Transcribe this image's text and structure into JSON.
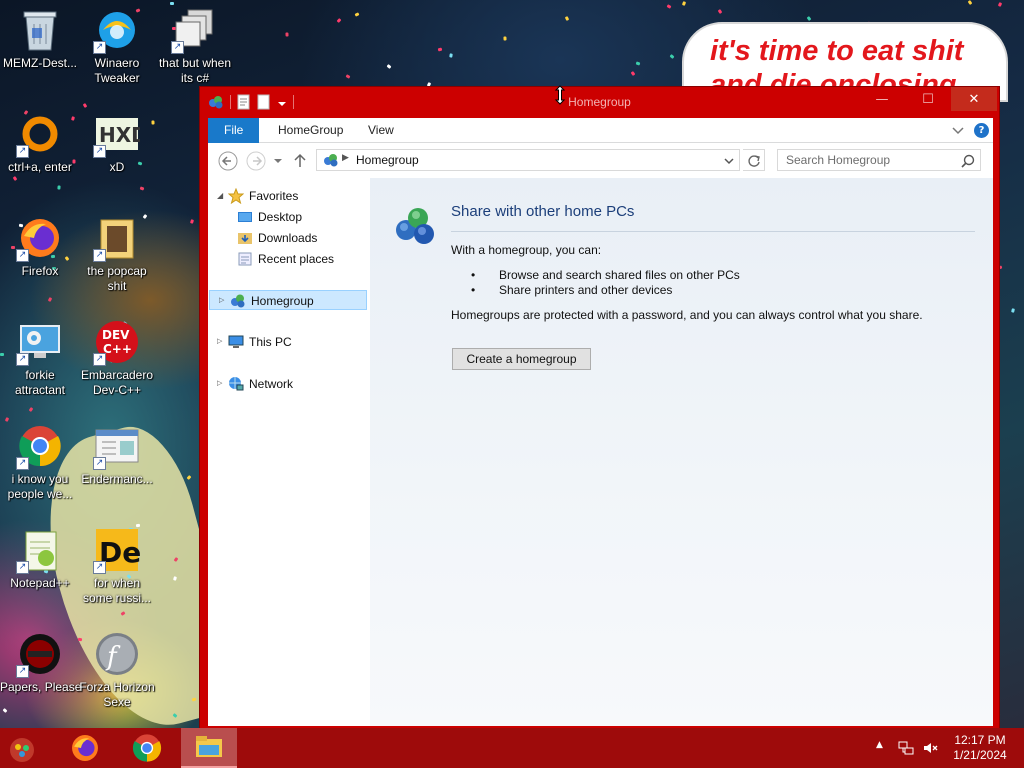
{
  "wallpaper": {
    "bubble_text": "it's time to eat shit\nand die onclosing"
  },
  "desktop_icons": [
    {
      "label": "MEMZ-Dest...",
      "icon": "recycle-bin"
    },
    {
      "label": "Winaero\nTweaker",
      "icon": "winaero"
    },
    {
      "label": "that but when\nits c#",
      "icon": "windows-stack"
    },
    {
      "label": "ctrl+a, enter",
      "icon": "orange-ring"
    },
    {
      "label": "xD",
      "icon": "hxd"
    },
    {
      "label": "Firefox",
      "icon": "firefox"
    },
    {
      "label": "the popcap\nshit",
      "icon": "popcap"
    },
    {
      "label": "forkie\nattractant",
      "icon": "computer-gear"
    },
    {
      "label": "Embarcadero\nDev-C++",
      "icon": "devcpp"
    },
    {
      "label": "i know you\npeople we...",
      "icon": "chrome"
    },
    {
      "label": "Endermanc...",
      "icon": "app-window"
    },
    {
      "label": "Notepad++",
      "icon": "notepad-plus-plus"
    },
    {
      "label": "for when\nsome russi...",
      "icon": "de-logo"
    },
    {
      "label": "Papers, Please",
      "icon": "papers-please"
    },
    {
      "label": "Forza Horizon\nSexe",
      "icon": "flash"
    }
  ],
  "window": {
    "title": "Homegroup",
    "ribbon_tabs": [
      "File",
      "HomeGroup",
      "View"
    ],
    "address": "Homegroup",
    "search_placeholder": "Search Homegroup",
    "nav": {
      "favorites": "Favorites",
      "favorites_items": [
        "Desktop",
        "Downloads",
        "Recent places"
      ],
      "homegroup": "Homegroup",
      "this_pc": "This PC",
      "network": "Network"
    },
    "content": {
      "heading": "Share with other home PCs",
      "intro": "With a homegroup, you can:",
      "bullets": [
        "Browse and search shared files on other PCs",
        "Share printers and other devices"
      ],
      "note": "Homegroups are protected with a password, and you can always control what you share.",
      "button": "Create a homegroup"
    }
  },
  "taskbar": {
    "apps": [
      "firefox",
      "chrome",
      "file-explorer"
    ],
    "active_app": "file-explorer",
    "time": "12:17 PM",
    "date": "1/21/2024"
  },
  "colors": {
    "window_frame": "#cc0000",
    "taskbar": "#9e0b0b",
    "file_tab": "#1979ca",
    "selection": "#cce8ff"
  }
}
